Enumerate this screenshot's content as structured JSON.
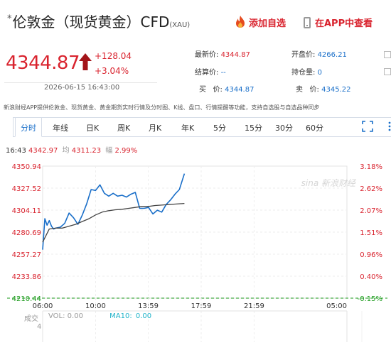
{
  "header": {
    "title": "伦敦金（现货黄金）CFD",
    "symbol": "(XAU)",
    "add_favorite": "添加自选",
    "app_link": "在APP中查看"
  },
  "quote": {
    "price": "4344.87",
    "change": "+128.04",
    "change_pct": "+3.04%",
    "timestamp": "2026-06-15 16:43:00"
  },
  "stats": {
    "latest_label": "最新价:",
    "latest_value": "4344.87",
    "open_label": "开盘价:",
    "open_value": "4266.21",
    "settle_label": "结算价:",
    "settle_value": "--",
    "position_label": "持仓量:",
    "position_value": "0",
    "bid_label": "买",
    "bid_sep": "价:",
    "bid_value": "4344.87",
    "ask_label": "卖",
    "ask_sep": "价:",
    "ask_value": "4345.22"
  },
  "info_text": "新浪财经APP提供伦敦金、现货黄金、黄金期货实时行情及分时图、K线、盘口、行情提醒等功能，支持自选股与自选品种同步",
  "tabs": [
    "分时",
    "年线",
    "日K",
    "周K",
    "月K",
    "年K",
    "5分",
    "15分",
    "30分",
    "60分"
  ],
  "readout": {
    "time": "16:43",
    "price": "4342.97",
    "avg_label": "均",
    "avg_value": "4311.23",
    "amp_label": "幅",
    "amp_value": "2.99%"
  },
  "volume": {
    "vol_label": "VOL:",
    "vol_value": "0.00",
    "ma_label": "MA10:",
    "ma_value": "0.00",
    "side_label": "成交",
    "side_value": "4"
  },
  "watermark": "sina 新浪财经",
  "colors": {
    "up": "#d9232e",
    "down": "#1a9a1a",
    "price_line": "#1a6fc9",
    "avg_line": "#444444",
    "link": "#1a6fc9",
    "ma": "#1fb3c9"
  },
  "chart_data": {
    "type": "line",
    "title": "",
    "x_ticks": [
      "06:00",
      "10:00",
      "13:59",
      "17:59",
      "21:59",
      "05:00"
    ],
    "y_ticks_left": [
      "4350.94",
      "4327.52",
      "4304.11",
      "4280.69",
      "4257.27",
      "4233.86",
      "4210.44"
    ],
    "y_ticks_right": [
      "3.18%",
      "2.62%",
      "2.07%",
      "1.51%",
      "0.96%",
      "0.40%",
      "-0.15%"
    ],
    "ylim": [
      4210.44,
      4350.94
    ],
    "session": [
      "06:00",
      "05:00"
    ],
    "series": [
      {
        "name": "",
        "x": [
          "06:00",
          "06:10",
          "06:20",
          "06:30",
          "06:40",
          "06:50",
          "07:00",
          "07:20",
          "07:40",
          "08:00",
          "08:20",
          "08:40",
          "09:00",
          "09:20",
          "09:40",
          "10:00",
          "10:20",
          "10:40",
          "11:00",
          "11:20",
          "11:40",
          "12:00",
          "12:20",
          "12:40",
          "13:00",
          "13:20",
          "13:40",
          "14:00",
          "14:20",
          "14:40",
          "15:00",
          "15:20",
          "15:40",
          "16:00",
          "16:20",
          "16:43"
        ],
        "values": [
          4262,
          4295,
          4288,
          4293,
          4287,
          4284,
          4285,
          4286,
          4290,
          4301,
          4296,
          4289,
          4299,
          4311,
          4326,
          4325,
          4331,
          4322,
          4319,
          4322,
          4319,
          4320,
          4318,
          4321,
          4323,
          4306,
          4306,
          4307,
          4300,
          4304,
          4302,
          4310,
          4315,
          4321,
          4326,
          4342.97
        ]
      },
      {
        "name": "",
        "x": [
          "06:00",
          "06:30",
          "07:00",
          "07:30",
          "08:00",
          "08:30",
          "09:00",
          "09:30",
          "10:00",
          "10:30",
          "11:00",
          "11:30",
          "12:00",
          "12:30",
          "13:00",
          "13:30",
          "14:00",
          "14:30",
          "15:00",
          "15:30",
          "16:00",
          "16:43"
        ],
        "values": [
          4270,
          4284,
          4285,
          4285,
          4287,
          4289,
          4292,
          4295,
          4299,
          4302,
          4303.5,
          4304.5,
          4305,
          4306,
          4307,
          4308,
          4308,
          4309,
          4309.5,
          4310,
          4310.5,
          4311.23
        ]
      }
    ]
  }
}
